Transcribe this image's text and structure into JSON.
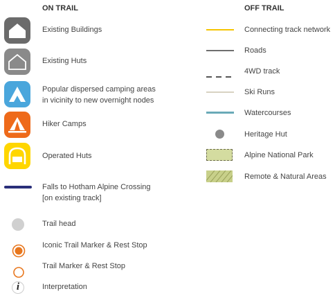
{
  "on_trail": {
    "heading": "ON TRAIL",
    "items": [
      {
        "icon": "existing-building-icon",
        "label": "Existing Buildings",
        "color": "#6b6b6b"
      },
      {
        "icon": "existing-hut-icon",
        "label": "Existing Huts",
        "color": "#8a8a8a"
      },
      {
        "icon": "camping-tent-icon",
        "label_line1": "Popular dispersed camping areas",
        "label_line2": "in vicinity to new overnight nodes",
        "color": "#4aa6dc"
      },
      {
        "icon": "hiker-camp-icon",
        "label": "Hiker Camps",
        "color": "#ee6a1a"
      },
      {
        "icon": "operated-hut-icon",
        "label": "Operated Huts",
        "color": "#ffd600"
      },
      {
        "icon": "navy-line",
        "label_line1": "Falls to Hotham Alpine Crossing",
        "label_line2": "[on existing track]",
        "color": "#2a2f7a"
      },
      {
        "icon": "trail-head-icon",
        "label": "Trail head",
        "color": "#d0d0d0"
      },
      {
        "icon": "trail-marker-rest-icon",
        "label": "Iconic Trail Marker & Rest Stop",
        "color": "#e8771e"
      },
      {
        "icon": "trail-marker-icon",
        "label": "Trail Marker & Rest Stop",
        "color": "#e8771e"
      },
      {
        "icon": "interpretation-icon",
        "label": "Interpretation",
        "glyph": "i"
      }
    ]
  },
  "off_trail": {
    "heading": "OFF TRAIL",
    "items": [
      {
        "icon": "connecting-track-line",
        "label": "Connecting track network",
        "color": "#f5c400"
      },
      {
        "icon": "road-line",
        "label": "Roads",
        "color": "#6e6e6e"
      },
      {
        "icon": "4wd-dashed-line",
        "label": "4WD track",
        "color": "#555555"
      },
      {
        "icon": "ski-run-line",
        "label": "Ski Runs",
        "color": "#d8d2c2"
      },
      {
        "icon": "watercourse-line",
        "label": "Watercourses",
        "color": "#6aaab8"
      },
      {
        "icon": "heritage-hut-icon",
        "label": "Heritage Hut",
        "color": "#8a8a8a"
      },
      {
        "icon": "alpine-np-swatch",
        "label": "Alpine National Park",
        "color": "#d4dca0"
      },
      {
        "icon": "remote-natural-swatch",
        "label": "Remote & Natural Areas",
        "color": "#c8d08a"
      }
    ]
  }
}
